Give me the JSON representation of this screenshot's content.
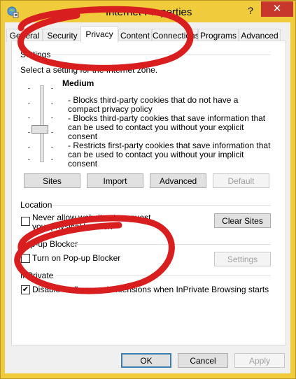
{
  "window": {
    "title": "Internet Properties",
    "help_glyph": "?",
    "close_glyph": "✕"
  },
  "tabs": [
    "General",
    "Security",
    "Privacy",
    "Content",
    "Connections",
    "Programs",
    "Advanced"
  ],
  "settings": {
    "header": "Settings",
    "select_label": "Select a setting for the Internet zone.",
    "level": "Medium",
    "descriptions": [
      "- Blocks third-party cookies that do not have a compact privacy policy",
      "- Blocks third-party cookies that save information that can be used to contact you without your explicit consent",
      "- Restricts first-party cookies that save information that can be used to contact you without your implicit consent"
    ],
    "buttons": {
      "sites": "Sites",
      "import": "Import",
      "advanced": "Advanced",
      "default": "Default"
    }
  },
  "location": {
    "header": "Location",
    "never_allow": "Never allow websites to request your physical location",
    "clear_sites": "Clear Sites"
  },
  "popup": {
    "header": "Pop-up Blocker",
    "turn_on": "Turn on Pop-up Blocker",
    "settings": "Settings"
  },
  "inprivate": {
    "header": "InPrivate",
    "disable_toolbars": "Disable toolbars and extensions when InPrivate Browsing starts",
    "checked": true
  },
  "footer": {
    "ok": "OK",
    "cancel": "Cancel",
    "apply": "Apply"
  },
  "colors": {
    "frame": "#f0cc3c",
    "close": "#c7372c",
    "annotation_ring": "#d81e1e"
  }
}
